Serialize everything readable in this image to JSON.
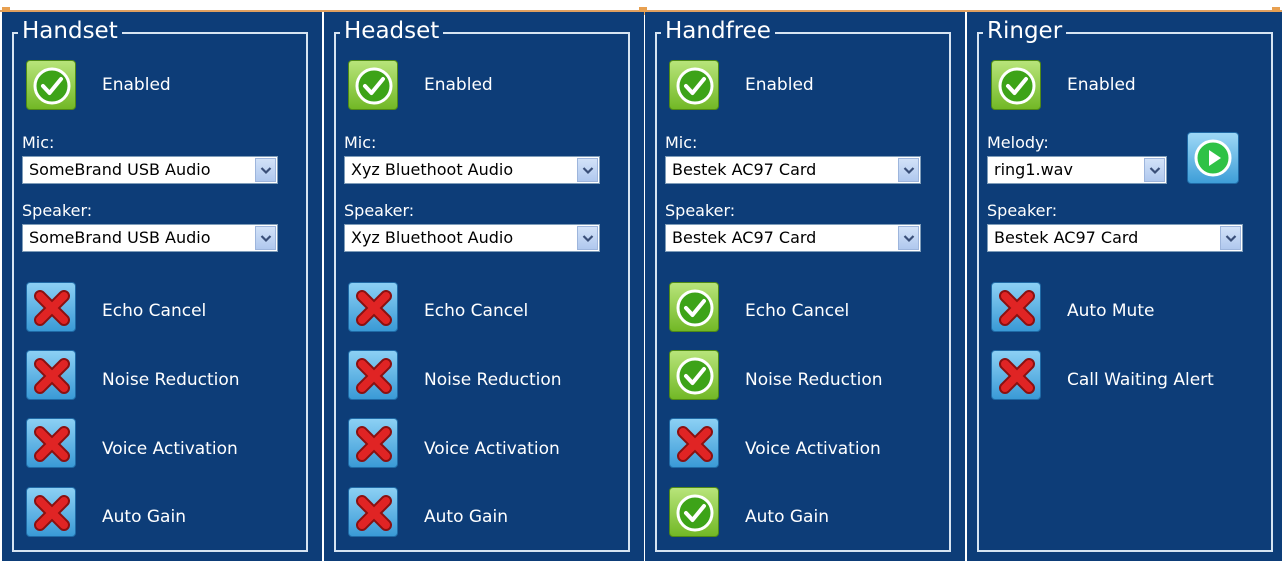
{
  "panels": [
    {
      "title": "Handset",
      "enabled": {
        "label": "Enabled",
        "checked": true
      },
      "fields": [
        {
          "label": "Mic:",
          "value": "SomeBrand USB Audio"
        },
        {
          "label": "Speaker:",
          "value": "SomeBrand USB Audio"
        }
      ],
      "options": [
        {
          "label": "Echo Cancel",
          "checked": false
        },
        {
          "label": "Noise Reduction",
          "checked": false
        },
        {
          "label": "Voice Activation",
          "checked": false
        },
        {
          "label": "Auto Gain",
          "checked": false
        }
      ]
    },
    {
      "title": "Headset",
      "enabled": {
        "label": "Enabled",
        "checked": true
      },
      "fields": [
        {
          "label": "Mic:",
          "value": "Xyz Bluethoot Audio"
        },
        {
          "label": "Speaker:",
          "value": "Xyz Bluethoot Audio"
        }
      ],
      "options": [
        {
          "label": "Echo Cancel",
          "checked": false
        },
        {
          "label": "Noise Reduction",
          "checked": false
        },
        {
          "label": "Voice Activation",
          "checked": false
        },
        {
          "label": "Auto Gain",
          "checked": false
        }
      ]
    },
    {
      "title": "Handfree",
      "enabled": {
        "label": "Enabled",
        "checked": true
      },
      "fields": [
        {
          "label": "Mic:",
          "value": "Bestek AC97 Card"
        },
        {
          "label": "Speaker:",
          "value": "Bestek AC97 Card"
        }
      ],
      "options": [
        {
          "label": "Echo Cancel",
          "checked": true
        },
        {
          "label": "Noise Reduction",
          "checked": true
        },
        {
          "label": "Voice Activation",
          "checked": false
        },
        {
          "label": "Auto Gain",
          "checked": true
        }
      ]
    },
    {
      "title": "Ringer",
      "enabled": {
        "label": "Enabled",
        "checked": true
      },
      "fields": [
        {
          "label": "Melody:",
          "value": "ring1.wav"
        },
        {
          "label": "Speaker:",
          "value": "Bestek AC97 Card"
        }
      ],
      "options": [
        {
          "label": "Auto Mute",
          "checked": false
        },
        {
          "label": "Call Waiting Alert",
          "checked": false
        }
      ]
    }
  ],
  "icons": {
    "checked": "check-circle-icon",
    "unchecked": "red-x-icon",
    "dropdown": "chevron-down-icon",
    "play": "play-icon"
  },
  "colors": {
    "panel_bg": "#0d3d78",
    "frame": "#d6e4f2",
    "on_button": "#8fcf3c",
    "off_button": "#5ab4e8",
    "cross": "#e02424",
    "play": "#2fc246"
  }
}
